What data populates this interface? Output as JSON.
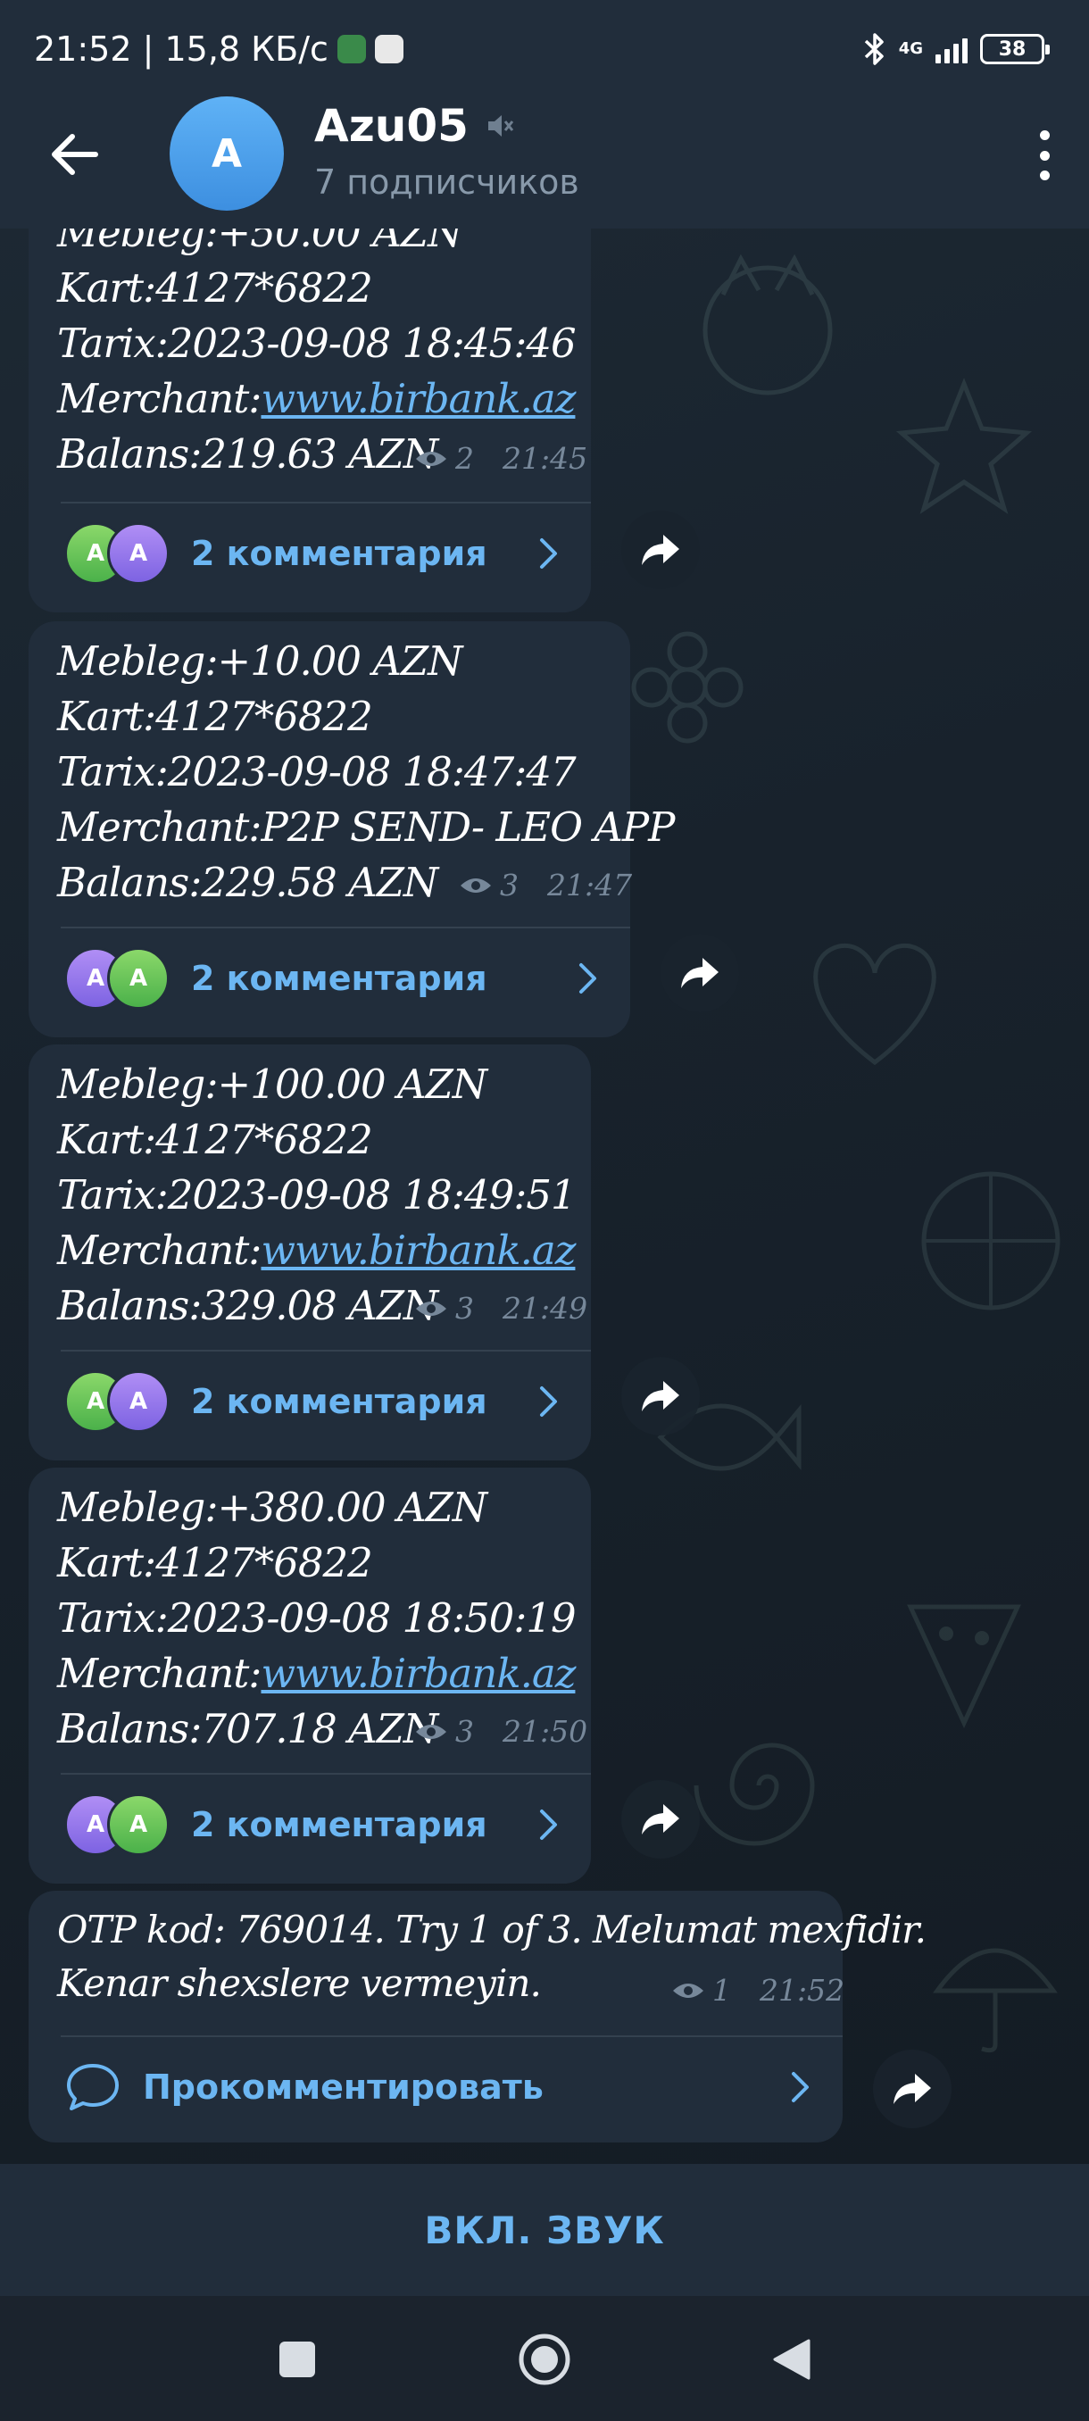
{
  "status_bar": {
    "left_text": "21:52 | 15,8 КБ/с",
    "network": "4G",
    "battery": "38"
  },
  "header": {
    "title": "Azu05",
    "subtitle": "7 подписчиков",
    "avatar_letter": "A"
  },
  "messages": [
    {
      "lines": [
        "Mebleg:+50.00 AZN",
        "Kart:4127*6822",
        "Tarix:2023-09-08 18:45:46",
        "Merchant:",
        "Balans:219.63 AZN"
      ],
      "merchant_link": "www.birbank.az",
      "views": "2",
      "time": "21:45",
      "comments_label": "2 комментария",
      "avatar_a": "A",
      "avatar_b": "A"
    },
    {
      "lines": [
        "Mebleg:+10.00 AZN",
        "Kart:4127*6822",
        "Tarix:2023-09-08 18:47:47",
        "Merchant:P2P SEND- LEO APP",
        "Balans:229.58 AZN"
      ],
      "views": "3",
      "time": "21:47",
      "comments_label": "2 комментария",
      "avatar_a": "A",
      "avatar_b": "A"
    },
    {
      "lines": [
        "Mebleg:+100.00 AZN",
        "Kart:4127*6822",
        "Tarix:2023-09-08 18:49:51",
        "Merchant:",
        "Balans:329.08 AZN"
      ],
      "merchant_link": "www.birbank.az",
      "views": "3",
      "time": "21:49",
      "comments_label": "2 комментария",
      "avatar_a": "A",
      "avatar_b": "A"
    },
    {
      "lines": [
        "Mebleg:+380.00 AZN",
        "Kart:4127*6822",
        "Tarix:2023-09-08 18:50:19",
        "Merchant:",
        "Balans:707.18 AZN"
      ],
      "merchant_link": "www.birbank.az",
      "views": "3",
      "time": "21:50",
      "comments_label": "2 комментария",
      "avatar_a": "A",
      "avatar_b": "A"
    },
    {
      "lines": [
        "OTP kod: 769014. Try 1 of 3. Melumat mexfidir.",
        "Kenar shexslere vermeyin."
      ],
      "views": "1",
      "time": "21:52",
      "comment_label": "Прокомментировать"
    }
  ],
  "bottom": {
    "unmute_label": "ВКЛ. ЗВУК"
  },
  "colors": {
    "accent": "#6cb6f2",
    "bubble": "#212d3b",
    "header": "#212d3b",
    "background": "#172029",
    "meta": "#77889a",
    "avatar_green": "#4bb14a",
    "avatar_purple": "#7d63e2"
  },
  "icons": {
    "back": "arrow-left-icon",
    "mute": "muted-speaker-icon",
    "more": "more-vertical-icon",
    "views": "eye-icon",
    "chevron": "chevron-right-icon",
    "share": "share-arrow-icon",
    "comment": "speech-bubble-icon",
    "bluetooth": "bluetooth-icon",
    "nav_recents": "square-icon",
    "nav_home": "circle-icon",
    "nav_back": "triangle-back-icon"
  }
}
